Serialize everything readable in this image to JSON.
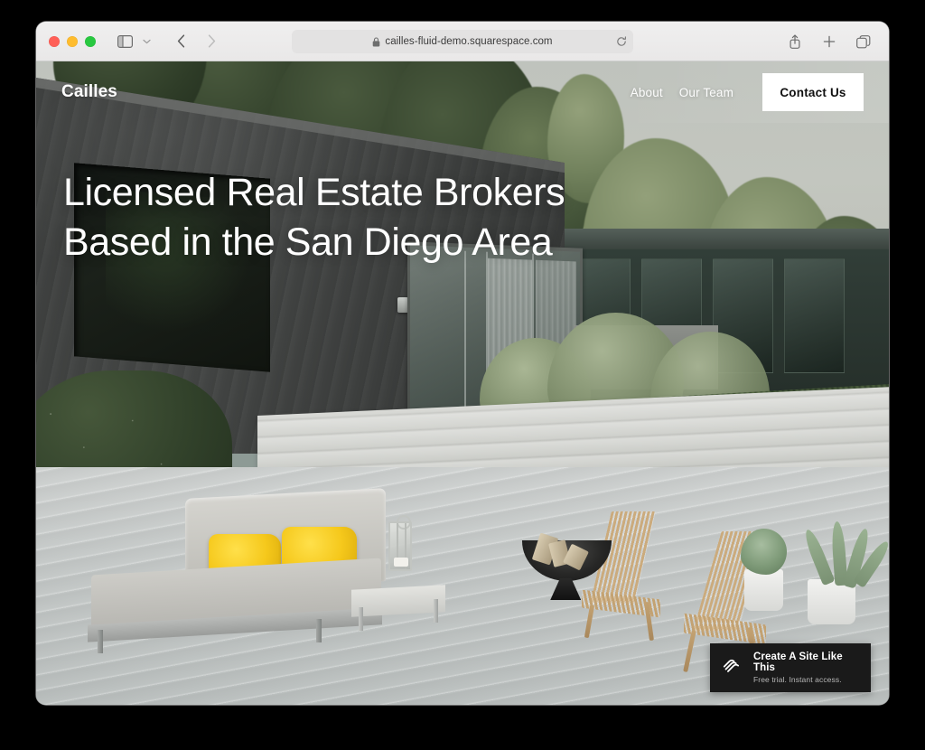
{
  "browser": {
    "traffic_lights": [
      "close",
      "minimize",
      "zoom"
    ],
    "sidebar_label": "Show Sidebar",
    "tab_overview_chevron": "chevron-down",
    "back_label": "Back",
    "forward_label": "Forward",
    "url": "cailles-fluid-demo.squarespace.com",
    "url_secure_icon": "lock-icon",
    "reload_label": "Reload",
    "share_label": "Share",
    "new_tab_label": "New Tab",
    "tabs_label": "Tab Overview"
  },
  "site": {
    "logo": "Cailles",
    "nav": [
      {
        "label": "About"
      },
      {
        "label": "Our Team"
      }
    ],
    "cta": {
      "label": "Contact Us"
    },
    "hero": {
      "headline": "Licensed Real Estate Brokers Based in the San Diego Area"
    }
  },
  "badge": {
    "icon": "squarespace-logo-icon",
    "title": "Create A Site Like This",
    "subtitle": "Free trial. Instant access."
  },
  "colors": {
    "badge_bg": "#1a1a1a",
    "cta_bg": "#ffffff",
    "cta_text": "#111111",
    "hero_text": "#ffffff",
    "pillow_yellow": "#f5c81b",
    "house_charcoal": "#3e403f",
    "deck_gray": "#c6cac9",
    "page_backdrop": "#000000"
  }
}
